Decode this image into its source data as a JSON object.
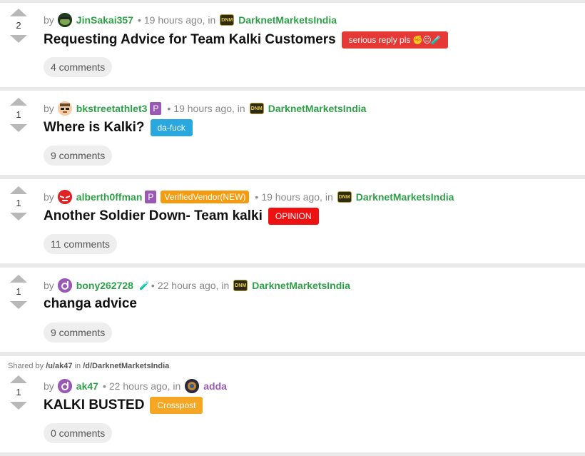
{
  "posts": [
    {
      "score": "2",
      "by": "by",
      "user": "JinSakai357",
      "time": "19 hours ago, in",
      "sub": "DarknetMarketsIndia",
      "title": "Requesting Advice for Team Kalki Customers",
      "flair": "serious reply pls",
      "flair_emoji": "✊😐🧪",
      "flair_color": "#e53935",
      "comments": "4 comments"
    },
    {
      "score": "1",
      "by": "by",
      "user": "bkstreetathlet3",
      "user_badge": "P",
      "time": "19 hours ago, in",
      "sub": "DarknetMarketsIndia",
      "title": "Where is Kalki?",
      "flair": "da-fuck",
      "flair_color": "#29a8e0",
      "comments": "9 comments"
    },
    {
      "score": "1",
      "by": "by",
      "user": "alberth0ffman",
      "user_badge": "P",
      "vendor_badge": "VerifiedVendor(NEW)",
      "time": "19 hours ago, in",
      "sub": "DarknetMarketsIndia",
      "title": "Another Soldier Down- Team kalki",
      "flair": "OPINION",
      "flair_color": "#ee1111",
      "comments": "11 comments"
    },
    {
      "score": "1",
      "by": "by",
      "user": "bony262728",
      "user_suffix": "🧪",
      "time": "22 hours ago, in",
      "sub": "DarknetMarketsIndia",
      "title": "changa advice",
      "comments": "9 comments"
    },
    {
      "shared_prefix": "Shared by",
      "shared_user": "/u/ak47",
      "shared_in": "in",
      "shared_sub": "/d/DarknetMarketsIndia",
      "score": "1",
      "by": "by",
      "user": "ak47",
      "time": "22 hours ago, in",
      "sub": "adda",
      "title": "KALKI BUSTED",
      "flair": "Crosspost",
      "flair_color": "#f5a623",
      "comments": "0 comments"
    }
  ],
  "sub_icon_text": "DNM",
  "colors": {
    "accent_green": "#2fa048",
    "badge_purple": "#9b59b6",
    "vendor_orange": "#f39c12"
  }
}
